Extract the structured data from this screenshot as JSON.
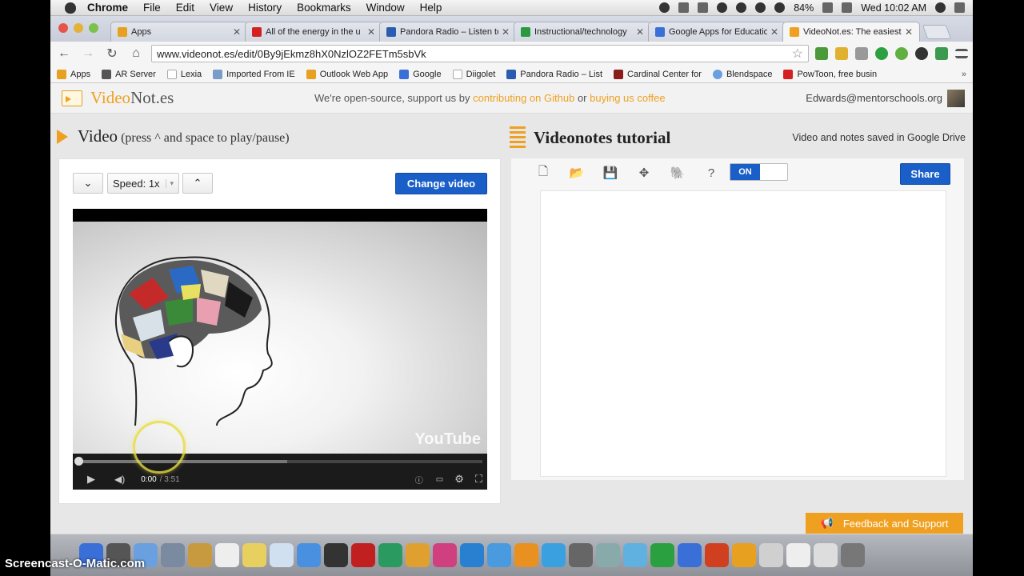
{
  "menubar": {
    "app": "Chrome",
    "items": [
      "File",
      "Edit",
      "View",
      "History",
      "Bookmarks",
      "Window",
      "Help"
    ],
    "battery": "84%",
    "clock": "Wed 10:02 AM"
  },
  "tabs": [
    {
      "title": "Apps",
      "color": "#e8a020"
    },
    {
      "title": "All of the energy in the u",
      "color": "#d42020"
    },
    {
      "title": "Pandora Radio – Listen to",
      "color": "#2a5db0"
    },
    {
      "title": "Instructional/technology",
      "color": "#2a9a40"
    },
    {
      "title": "Google Apps for Educatio",
      "color": "#3b6fd8"
    },
    {
      "title": "VideoNot.es: The easiest",
      "color": "#f0a020"
    }
  ],
  "toolbar": {
    "url": "www.videonot.es/edit/0By9jEkmz8hX0NzlOZ2FETm5sbVk"
  },
  "bookmarks": [
    {
      "label": "Apps",
      "color": "#e8a020"
    },
    {
      "label": "AR Server",
      "color": "#555555"
    },
    {
      "label": "Lexia",
      "color": "#cccccc"
    },
    {
      "label": "Imported From IE",
      "color": "#7a9cc8"
    },
    {
      "label": "Outlook Web App",
      "color": "#e8a020"
    },
    {
      "label": "Google",
      "color": "#3b6fd8"
    },
    {
      "label": "Diigolet",
      "color": "#cccccc"
    },
    {
      "label": "Pandora Radio – List",
      "color": "#2a5db0"
    },
    {
      "label": "Cardinal Center for",
      "color": "#8a1c1c"
    },
    {
      "label": "Blendspace",
      "color": "#6aa0e0"
    },
    {
      "label": "PowToon, free busin",
      "color": "#d42020"
    }
  ],
  "header": {
    "logo_a": "Video",
    "logo_b": "Not.es",
    "msg_prefix": "We're open-source, support us by",
    "link_github": "contributing on Github",
    "msg_or": "or",
    "link_coffee": "buying us coffee",
    "user": "Edwards@mentorschools.org"
  },
  "video": {
    "heading": "Video",
    "subheading": "(press ^ and space to play/pause)",
    "speed_label": "Speed: 1x",
    "change_label": "Change video",
    "yt_logo": "YouTube",
    "time_current": "0:00",
    "time_total": "/ 3:51",
    "progress": 0
  },
  "notes": {
    "title": "Videonotes tutorial",
    "saved_text": "Video and notes saved in Google Drive",
    "toggle_label": "ON",
    "share_label": "Share"
  },
  "feedback_label": "Feedback and Support",
  "watermark": "Screencast-O-Matic.com",
  "dock_colors": [
    "#3b6fd8",
    "#555",
    "#6aa0e0",
    "#7a8aa0",
    "#c89a40",
    "#eeeeee",
    "#e8d060",
    "#d0e0f0",
    "#4a90e0",
    "#333",
    "#c02020",
    "#2a9a60",
    "#e0a030",
    "#d04080",
    "#2a80d0",
    "#4a9ae0",
    "#e89020",
    "#3aa0e0",
    "#666",
    "#8aa",
    "#60b0e0",
    "#2aa040",
    "#3b6fd8",
    "#d04020",
    "#e8a020",
    "#d0d0d0",
    "#eeeeee",
    "#dddddd",
    "#777"
  ]
}
